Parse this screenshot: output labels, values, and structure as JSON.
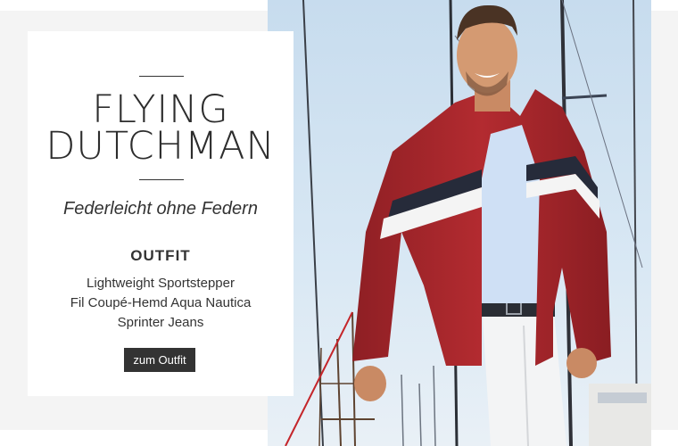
{
  "promo": {
    "brand_line1": "FLYING",
    "brand_line2": "DUTCHMAN",
    "tagline": "Federleicht ohne Federn",
    "outfit_heading": "OUTFIT",
    "items": [
      "Lightweight Sportstepper",
      "Fil Coupé-Hemd Aqua Nautica",
      "Sprinter Jeans"
    ],
    "cta_label": "zum Outfit"
  },
  "colors": {
    "page_bg": "#f4f4f4",
    "card_bg": "#ffffff",
    "text": "#2d2d2d",
    "button_bg": "#333333",
    "jacket_red": "#a8262b",
    "sky_blue": "#cfe2f2"
  },
  "icons": [
    "photo-man-sailboat"
  ]
}
